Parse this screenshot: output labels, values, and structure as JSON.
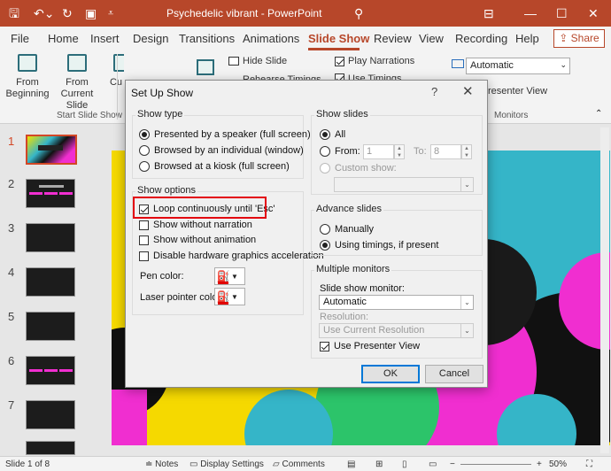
{
  "window": {
    "title": "Psychedelic vibrant  -  PowerPoint",
    "accent": "#b7472a",
    "icons": [
      "save-icon",
      "undo-icon",
      "redo-icon",
      "present-icon",
      "qat-customize-icon",
      "search-icon",
      "ribbon-display-icon",
      "minimize-icon",
      "maximize-icon",
      "close-icon"
    ]
  },
  "tabs": [
    "File",
    "Home",
    "Insert",
    "Design",
    "Transitions",
    "Animations",
    "Slide Show",
    "Review",
    "View",
    "Recording",
    "Help"
  ],
  "active_tab": "Slide Show",
  "share_label": "Share",
  "ribbon": {
    "from_beginning": "From Beginning",
    "from_current": "From Current Slide",
    "custom_partial": "Cu",
    "group_start": "Start Slide Show",
    "hide_slide": "Hide Slide",
    "rehearse_partial": "Rehearse Timings",
    "play_narrations": "Play Narrations",
    "use_timings_partial": "Use Timings",
    "monitor_select": "Automatic",
    "presenter_view_partial": "resenter View",
    "group_monitors": "Monitors"
  },
  "thumbnails": [
    "1",
    "2",
    "3",
    "4",
    "5",
    "6",
    "7"
  ],
  "status": {
    "slide_count": "Slide 1 of 8",
    "notes": "Notes",
    "display_settings": "Display Settings",
    "comments": "Comments",
    "zoom": "50%"
  },
  "dialog": {
    "title": "Set Up Show",
    "help": "?",
    "show_type": {
      "label": "Show type",
      "options": [
        "Presented by a speaker (full screen)",
        "Browsed by an individual (window)",
        "Browsed at a kiosk (full screen)"
      ],
      "selected": 0
    },
    "show_options": {
      "label": "Show options",
      "items": [
        {
          "label": "Loop continuously until 'Esc'",
          "checked": true
        },
        {
          "label": "Show without narration",
          "checked": false
        },
        {
          "label": "Show without animation",
          "checked": false
        },
        {
          "label": "Disable hardware graphics acceleration",
          "checked": false
        }
      ],
      "pen_color": "Pen color:",
      "laser_color": "Laser pointer color:"
    },
    "show_slides": {
      "label": "Show slides",
      "all": "All",
      "from": "From:",
      "from_value": "1",
      "to": "To:",
      "to_value": "8",
      "custom": "Custom show:"
    },
    "advance_slides": {
      "label": "Advance slides",
      "manually": "Manually",
      "using_timings": "Using timings, if present"
    },
    "monitors": {
      "label": "Multiple monitors",
      "monitor_label": "Slide show monitor:",
      "monitor_value": "Automatic",
      "resolution_label": "Resolution:",
      "resolution_value": "Use Current Resolution",
      "presenter_view": "Use Presenter View"
    },
    "ok": "OK",
    "cancel": "Cancel"
  }
}
